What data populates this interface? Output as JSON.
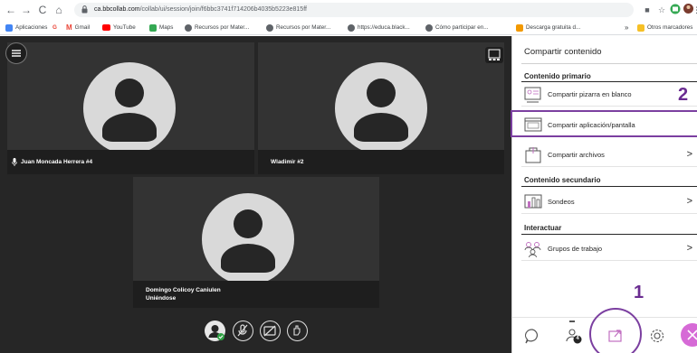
{
  "browser": {
    "url_host": "ca.bbcollab.com",
    "url_path": "/collab/ui/session/join/f6bbc3741f714206b4035b5223e815ff",
    "bookmarks": [
      {
        "label": "Aplicaciones",
        "icon": "apps-grid-icon",
        "color": "#4285f4"
      },
      {
        "label": "G",
        "icon": "google-icon",
        "color": "#ea4335"
      },
      {
        "label": "Gmail",
        "icon": "gmail-icon",
        "color": "#ea4335"
      },
      {
        "label": "YouTube",
        "icon": "youtube-icon",
        "color": "#ff0000"
      },
      {
        "label": "Maps",
        "icon": "maps-icon",
        "color": "#34a853"
      },
      {
        "label": "Recursos por Mater...",
        "icon": "globe-icon",
        "color": "#5f6368"
      },
      {
        "label": "Recursos por Mater...",
        "icon": "globe-icon",
        "color": "#5f6368"
      },
      {
        "label": "https://educa.black...",
        "icon": "globe-icon",
        "color": "#5f6368"
      },
      {
        "label": "Cómo participar en...",
        "icon": "globe-icon",
        "color": "#5f6368"
      },
      {
        "label": "Descarga gratuita d...",
        "icon": "orange-square-icon",
        "color": "#f29900"
      },
      {
        "label": "»",
        "icon": "",
        "color": ""
      },
      {
        "label": "Otros marcadores",
        "icon": "folder-icon",
        "color": "#f6c026"
      }
    ]
  },
  "participants": [
    {
      "name": "Juan Moncada Herrera #4"
    },
    {
      "name": "Wladimir #2"
    },
    {
      "name": "Domingo Colicoy Caniulen",
      "status": "Uniéndose"
    }
  ],
  "panel": {
    "title": "Compartir contenido",
    "primary_heading": "Contenido primario",
    "secondary_heading": "Contenido secundario",
    "interact_heading": "Interactuar",
    "items": {
      "whiteboard": "Compartir pizarra en blanco",
      "app_screen": "Compartir aplicación/pantalla",
      "files": "Compartir archivos",
      "polls": "Sondeos",
      "groups": "Grupos de trabajo"
    },
    "chevron": ">"
  },
  "annotations": {
    "step1": "1",
    "step2": "2"
  },
  "attendees_count": "4",
  "colors": {
    "annotation": "#7b3fa0",
    "stage": "#262626",
    "close_button": "#d66ad6"
  }
}
